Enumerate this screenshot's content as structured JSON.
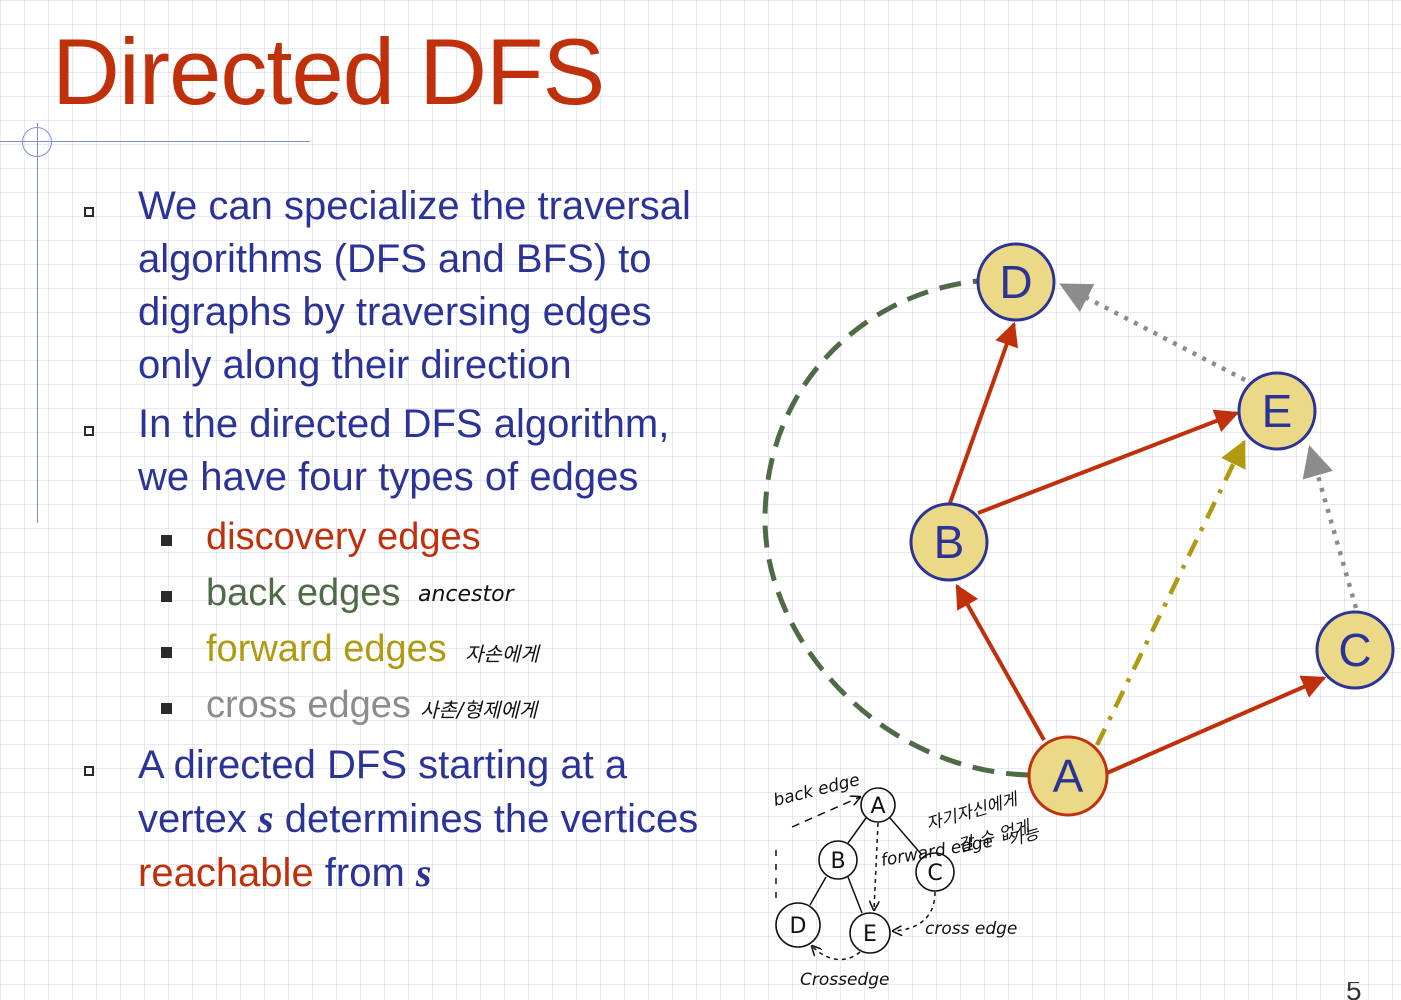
{
  "slide": {
    "title": "Directed DFS",
    "page_number": "5"
  },
  "bullets": [
    {
      "lines": [
        "We can specialize the traversal",
        "algorithms (DFS and BFS) to",
        "digraphs by traversing edges",
        "only along their direction"
      ]
    },
    {
      "lines": [
        "In the directed DFS algorithm,",
        "we have four types of edges"
      ]
    }
  ],
  "edge_types": [
    {
      "label": "discovery edges",
      "color": "#C0300A",
      "note": ""
    },
    {
      "label": "back edges",
      "color": "#4F6B45",
      "note": "ancestor"
    },
    {
      "label": "forward edges",
      "color": "#B09A10",
      "note": "자손에게"
    },
    {
      "label": "cross edges",
      "color": "#8C8C8C",
      "note": "사촌/형제에게"
    }
  ],
  "bullet3": {
    "line1": "A directed DFS starting at a",
    "line2_pre": "vertex ",
    "var": "s",
    "line2_post": " determines the vertices",
    "line3_red": "reachable",
    "line3_post": " from "
  },
  "graph": {
    "nodes": [
      "A",
      "B",
      "C",
      "D",
      "E"
    ],
    "node_fill": "#EBD988",
    "node_stroke": "#2B3496",
    "edges": [
      {
        "from": "A",
        "to": "B",
        "type": "discovery"
      },
      {
        "from": "B",
        "to": "D",
        "type": "discovery"
      },
      {
        "from": "B",
        "to": "E",
        "type": "discovery"
      },
      {
        "from": "A",
        "to": "C",
        "type": "discovery"
      },
      {
        "from": "A",
        "to": "D",
        "type": "back"
      },
      {
        "from": "A",
        "to": "E",
        "type": "forward"
      },
      {
        "from": "E",
        "to": "D",
        "type": "cross"
      },
      {
        "from": "C",
        "to": "E",
        "type": "cross"
      }
    ]
  },
  "handwriting": {
    "back_edge": "back edge",
    "forward_edge": "forward edge",
    "cross_edge_right": "cross edge",
    "cross_edge_bottom": "Crossedge",
    "korean_note_1": "자기자신에게",
    "korean_note_2": "갈 수 없게",
    "korean_note_3": "가능",
    "sketch_nodes": [
      "A",
      "B",
      "C",
      "D",
      "E"
    ]
  }
}
